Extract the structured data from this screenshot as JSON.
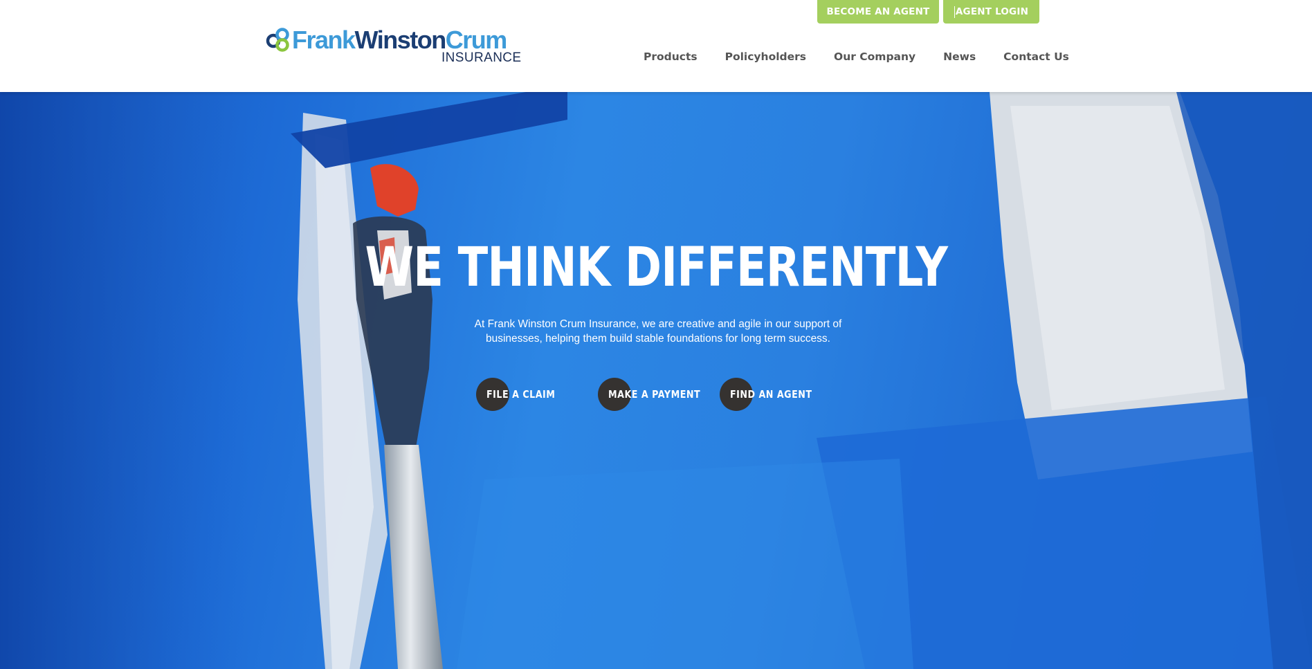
{
  "brand": {
    "name_part1": "Frank",
    "name_part2": "Winston",
    "name_part3": "Crum",
    "subtitle": "INSURANCE",
    "colors": {
      "light_blue": "#3d9ad8",
      "navy": "#1b3e73",
      "green": "#a4cf5e"
    }
  },
  "utility_nav": {
    "become_agent": "BECOME AN AGENT",
    "agent_login": "AGENT LOGIN"
  },
  "main_nav": {
    "items": [
      {
        "label": "Products"
      },
      {
        "label": "Policyholders"
      },
      {
        "label": "Our Company"
      },
      {
        "label": "News"
      },
      {
        "label": "Contact Us"
      }
    ]
  },
  "hero": {
    "title": "WE THINK DIFFERENTLY",
    "subtitle": "At Frank Winston Crum Insurance, we are creative and agile in our support of businesses, helping them build stable foundations for long term success.",
    "ctas": [
      {
        "label": "FILE A CLAIM"
      },
      {
        "label": "MAKE A PAYMENT"
      },
      {
        "label": "FIND AN AGENT"
      }
    ],
    "background": "paint-roller-blue-wall-image"
  }
}
